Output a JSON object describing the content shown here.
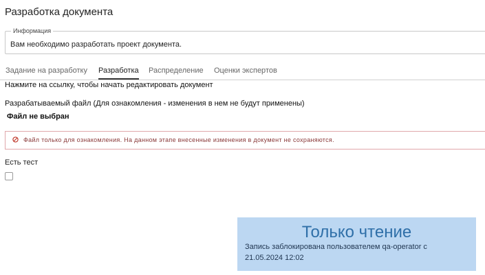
{
  "page": {
    "title": "Разработка документа"
  },
  "info": {
    "legend": "Информация",
    "text": "Вам необходимо разработать проект документа."
  },
  "tabs": [
    {
      "label": "Задание на разработку",
      "active": false
    },
    {
      "label": "Разработка",
      "active": true
    },
    {
      "label": "Распределение",
      "active": false
    },
    {
      "label": "Оценки экспертов",
      "active": false
    }
  ],
  "content": {
    "hint": "Нажмите на ссылку, чтобы начать редактировать документ",
    "file_label": "Разрабатываемый файл (Для ознакомления - изменения в нем не будут применены)",
    "file_value": "Файл не выбран",
    "warning": {
      "icon": "forbidden-icon",
      "text": "Файл только для ознакомления. На данном этапе внесенные изменения в документ не сохраняются.",
      "color": "#c0392b"
    },
    "test_label": "Есть тест",
    "test_checked": false
  },
  "readonly": {
    "title": "Только чтение",
    "message": "Запись заблокирована пользователем qa-operator с 21.05.2024 12:02"
  }
}
